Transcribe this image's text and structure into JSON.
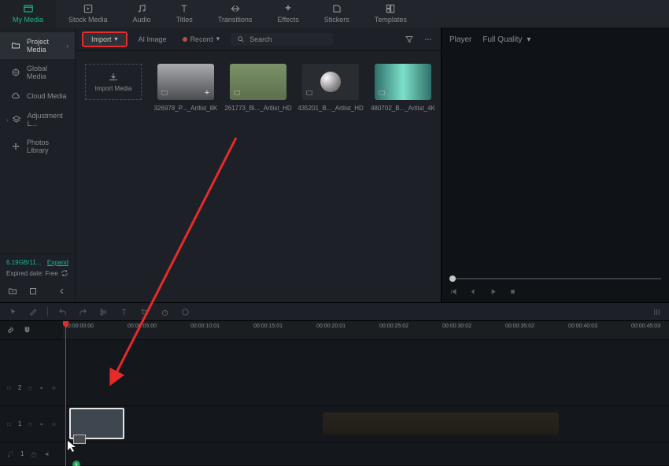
{
  "top_tabs": {
    "my_media": "My Media",
    "stock_media": "Stock Media",
    "audio": "Audio",
    "titles": "Titles",
    "transitions": "Transitions",
    "effects": "Effects",
    "stickers": "Stickers",
    "templates": "Templates"
  },
  "sidebar": {
    "items": [
      {
        "label": "Project Media"
      },
      {
        "label": "Global Media"
      },
      {
        "label": "Cloud Media"
      },
      {
        "label": "Adjustment L..."
      },
      {
        "label": "Photos Library"
      }
    ],
    "storage": "6.19GB/11...",
    "expand": "Expand",
    "expired": "Expired date: Free"
  },
  "media_toolbar": {
    "import": "Import",
    "ai_image": "AI Image",
    "record": "Record",
    "search_placeholder": "Search"
  },
  "media": {
    "import_tile": "Import Media",
    "items": [
      {
        "label": "326978_P..._Artlist_8K"
      },
      {
        "label": "261773_Bi..._Artlist_HD"
      },
      {
        "label": "435201_B..._Artlist_HD"
      },
      {
        "label": "480702_B..._Artlist_4K"
      }
    ]
  },
  "player": {
    "label": "Player",
    "quality": "Full Quality"
  },
  "ruler": {
    "ticks": [
      "00:00:00:00",
      "00:00:05:00",
      "00:00:10:01",
      "00:00:15:01",
      "00:00:20:01",
      "00:00:25:02",
      "00:00:30:02",
      "00:00:35:02",
      "00:00:40:03",
      "00:00:45:03"
    ]
  },
  "tracks": {
    "v2": "2",
    "v1": "1",
    "a1": "1"
  }
}
